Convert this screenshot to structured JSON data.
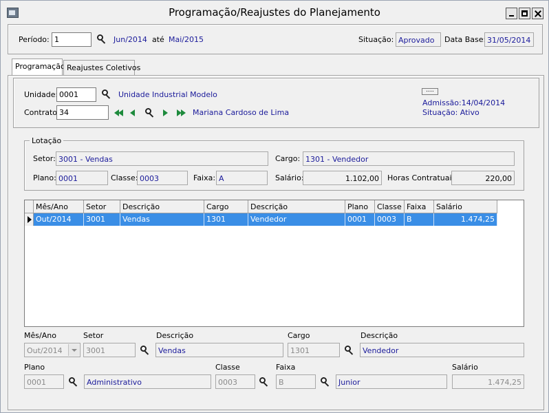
{
  "window": {
    "title": "Programação/Reajustes do Planejamento"
  },
  "header": {
    "periodo_label": "Período:",
    "periodo_value": "1",
    "periodo_inicio": "Jun/2014",
    "ate_label": "até",
    "periodo_fim": "Mai/2015",
    "situacao_label": "Situação:",
    "situacao_value": "Aprovado",
    "database_label": "Data Base:",
    "database_value": "31/05/2014"
  },
  "tabs": [
    {
      "label": "Programação",
      "active": true
    },
    {
      "label": "Reajustes Coletivos",
      "active": false
    }
  ],
  "employee": {
    "unidade_label": "Unidade:",
    "unidade_value": "0001",
    "unidade_nome": "Unidade Industrial Modelo",
    "contrato_label": "Contrato:",
    "contrato_value": "34",
    "contrato_nome": "Mariana Cardoso de Lima",
    "ellipsis_label": "....",
    "admissao": "Admissão:14/04/2014",
    "situacao": "Situação: Ativo"
  },
  "lotacao": {
    "legend": "Lotação",
    "setor_label": "Setor:",
    "setor_value": "3001 - Vendas",
    "cargo_label": "Cargo:",
    "cargo_value": "1301 - Vendedor",
    "plano_label": "Plano:",
    "plano_value": "0001",
    "classe_label": "Classe:",
    "classe_value": "0003",
    "faixa_label": "Faixa:",
    "faixa_value": "A",
    "salario_label": "Salário:",
    "salario_value": "1.102,00",
    "horas_label": "Horas Contratuais:",
    "horas_value": "220,00"
  },
  "grid": {
    "columns": [
      "Mês/Ano",
      "Setor",
      "Descrição",
      "Cargo",
      "Descrição",
      "Plano",
      "Classe",
      "Faixa",
      "Salário"
    ],
    "rows": [
      [
        "Out/2014",
        "3001",
        "Vendas",
        "1301",
        "Vendedor",
        "0001",
        "0003",
        "B",
        "1.474,25"
      ]
    ]
  },
  "detail": {
    "mesano_label": "Mês/Ano",
    "mesano_value": "Out/2014",
    "setor_label": "Setor",
    "setor_value": "3001",
    "setor_desc_label": "Descrição",
    "setor_desc_value": "Vendas",
    "cargo_label": "Cargo",
    "cargo_value": "1301",
    "cargo_desc_label": "Descrição",
    "cargo_desc_value": "Vendedor",
    "plano_label": "Plano",
    "plano_value": "0001",
    "plano_desc_value": "Administrativo",
    "classe_label": "Classe",
    "classe_value": "0003",
    "faixa_label": "Faixa",
    "faixa_value": "B",
    "faixa_desc_value": "Junior",
    "salario_label": "Salário",
    "salario_value": "1.474,25"
  }
}
